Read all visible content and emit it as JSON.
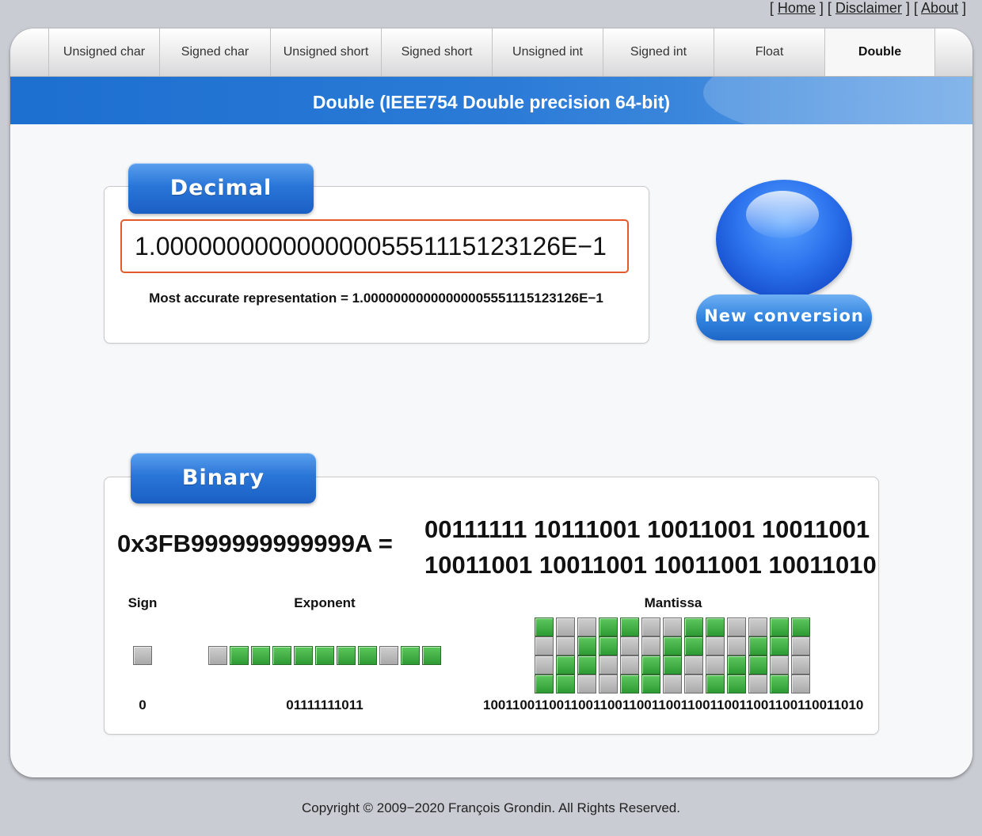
{
  "top_links": {
    "open": "[ ",
    "home": "Home",
    "sep1": " ] [ ",
    "disclaimer": "Disclaimer",
    "sep2": " ] [ ",
    "about": "About",
    "close": " ]"
  },
  "tabs": [
    "Unsigned char",
    "Signed char",
    "Unsigned short",
    "Signed short",
    "Unsigned int",
    "Signed int",
    "Float",
    "Double"
  ],
  "active_tab": "Double",
  "title": "Double (IEEE754 Double precision 64-bit)",
  "decimal": {
    "header": "Decimal",
    "value": "1.00000000000000005551115123126E−1",
    "note": "Most accurate representation = 1.00000000000000005551115123126E−1"
  },
  "new_conversion": "New conversion",
  "binary": {
    "header": "Binary",
    "hex": "0x3FB999999999999A =",
    "bytes_line1": "00111111 10111001 10011001 10011001",
    "bytes_line2": "10011001 10011001 10011001 10011010",
    "sign_label": "Sign",
    "exponent_label": "Exponent",
    "mantissa_label": "Mantissa",
    "sign_bits": "0",
    "exponent_bits": "01111111011",
    "mantissa_bits": "1001100110011001100110011001100110011001100110011010"
  },
  "colors": {
    "bit_on": "#3aa83f",
    "bit_off": "#b5b5b5",
    "accent": "#2a76d8",
    "input_border": "#e45a2a"
  },
  "footer": "Copyright © 2009−2020 François Grondin. All Rights Reserved."
}
